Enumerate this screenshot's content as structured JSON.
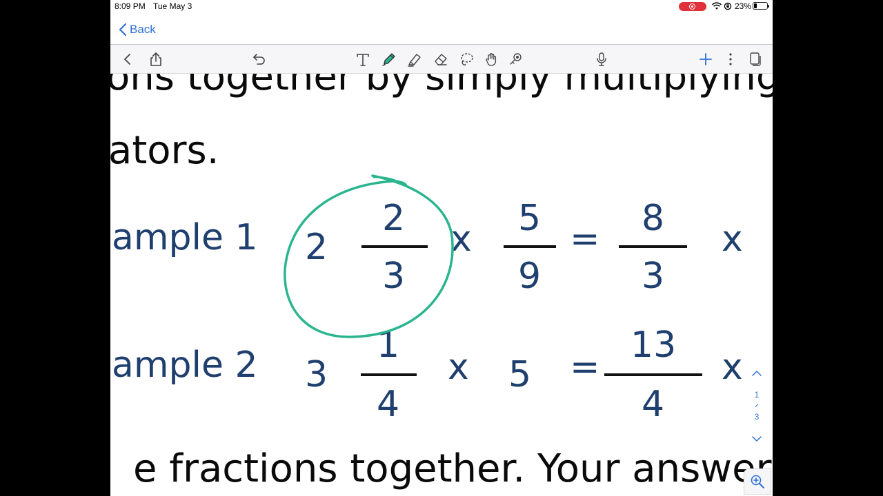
{
  "status_bar": {
    "time": "8:09 PM",
    "date": "Tue May 3",
    "battery_percent": "23%",
    "recording_color": "#e0303a"
  },
  "nav": {
    "back_label": "Back",
    "accent_color": "#2f6fd8"
  },
  "toolbar": {
    "left_tools": [
      "chevron-left-icon",
      "share-icon"
    ],
    "undo": "undo-icon",
    "tools": [
      "text-tool-icon",
      "pen-tool-icon",
      "highlighter-tool-icon",
      "eraser-tool-icon",
      "lasso-tool-icon",
      "hand-tool-icon",
      "laser-pointer-icon"
    ],
    "right_tools": [
      "microphone-icon",
      "plus-icon",
      "more-vertical-icon",
      "pages-icon"
    ],
    "active_tool": "pen-tool-icon"
  },
  "document": {
    "line1": "ons together by simply multiplying t",
    "line2": "ators.",
    "line3": "e fractions together. Your answer ca",
    "text_color": "#1f3f6e",
    "example1": {
      "label": "ample 1",
      "whole": "2",
      "numerator": "2",
      "denominator": "3",
      "op1": "x",
      "numerator2": "5",
      "denominator2": "9",
      "equals": "=",
      "result_numerator": "8",
      "result_denominator": "3",
      "op2": "x"
    },
    "example2": {
      "label": "ample 2",
      "whole": "3",
      "numerator": "1",
      "denominator": "4",
      "op1": "x",
      "number2": "5",
      "equals": "=",
      "result_numerator": "13",
      "result_denominator": "4",
      "op2": "x"
    }
  },
  "annotation": {
    "stroke_color": "#2bb58f",
    "shape": "circle around mixed number 2 2/3"
  },
  "page_indicator": {
    "current": "1",
    "total": "3"
  },
  "zoom": "zoom-in-icon"
}
